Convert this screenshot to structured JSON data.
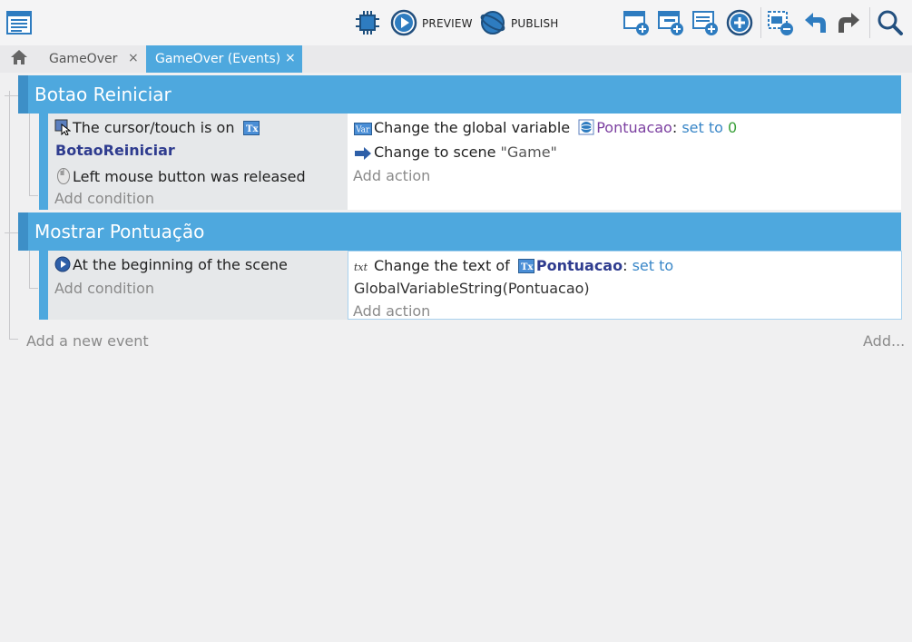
{
  "toolbar": {
    "preview_label": "PREVIEW",
    "publish_label": "PUBLISH",
    "icons": [
      "events-sheet-icon",
      "debugger-chip-icon",
      "preview-play-icon",
      "publish-globe-icon",
      "add-event-icon",
      "add-subevent-icon",
      "add-comment-icon",
      "add-other-icon",
      "delete-event-icon",
      "undo-icon",
      "redo-icon",
      "search-icon"
    ]
  },
  "tabs": [
    {
      "label": "GameOver",
      "close": "×",
      "active": false
    },
    {
      "label": "GameOver (Events)",
      "close": "×",
      "active": true
    }
  ],
  "events": [
    {
      "group_title": "Botao Reiniciar",
      "conditions": [
        {
          "icon": "cursor-on-object-icon",
          "text": "The cursor/touch is on",
          "object": "BotaoReiniciar"
        },
        {
          "icon": "mouse-icon",
          "text": "Left mouse button was released"
        }
      ],
      "add_condition": "Add condition",
      "actions": [
        {
          "icon": "variable-icon",
          "text": "Change the global variable",
          "variable": "Pontuacao",
          "sep": ":",
          "op": "set to",
          "value": "0"
        },
        {
          "icon": "scene-arrow-icon",
          "text": "Change to scene",
          "value": "\"Game\""
        }
      ],
      "add_action": "Add action"
    },
    {
      "group_title": "Mostrar Pontuação",
      "conditions": [
        {
          "icon": "play-start-icon",
          "text": "At the beginning of the scene"
        }
      ],
      "add_condition": "Add condition",
      "actions": [
        {
          "icon": "text-icon",
          "text": "Change the text of",
          "object": "Pontuacao",
          "sep": ":",
          "op": "set to",
          "value": "GlobalVariableString(Pontuacao)"
        }
      ],
      "add_action": "Add action"
    }
  ],
  "footer": {
    "add_new_event": "Add a new event",
    "add_more": "Add..."
  },
  "colors": {
    "group_header": "#4ea8de",
    "object_name": "#2f3c8f",
    "variable": "#7b3fa0",
    "keyword": "#3a87c8",
    "number": "#3aa03a"
  }
}
